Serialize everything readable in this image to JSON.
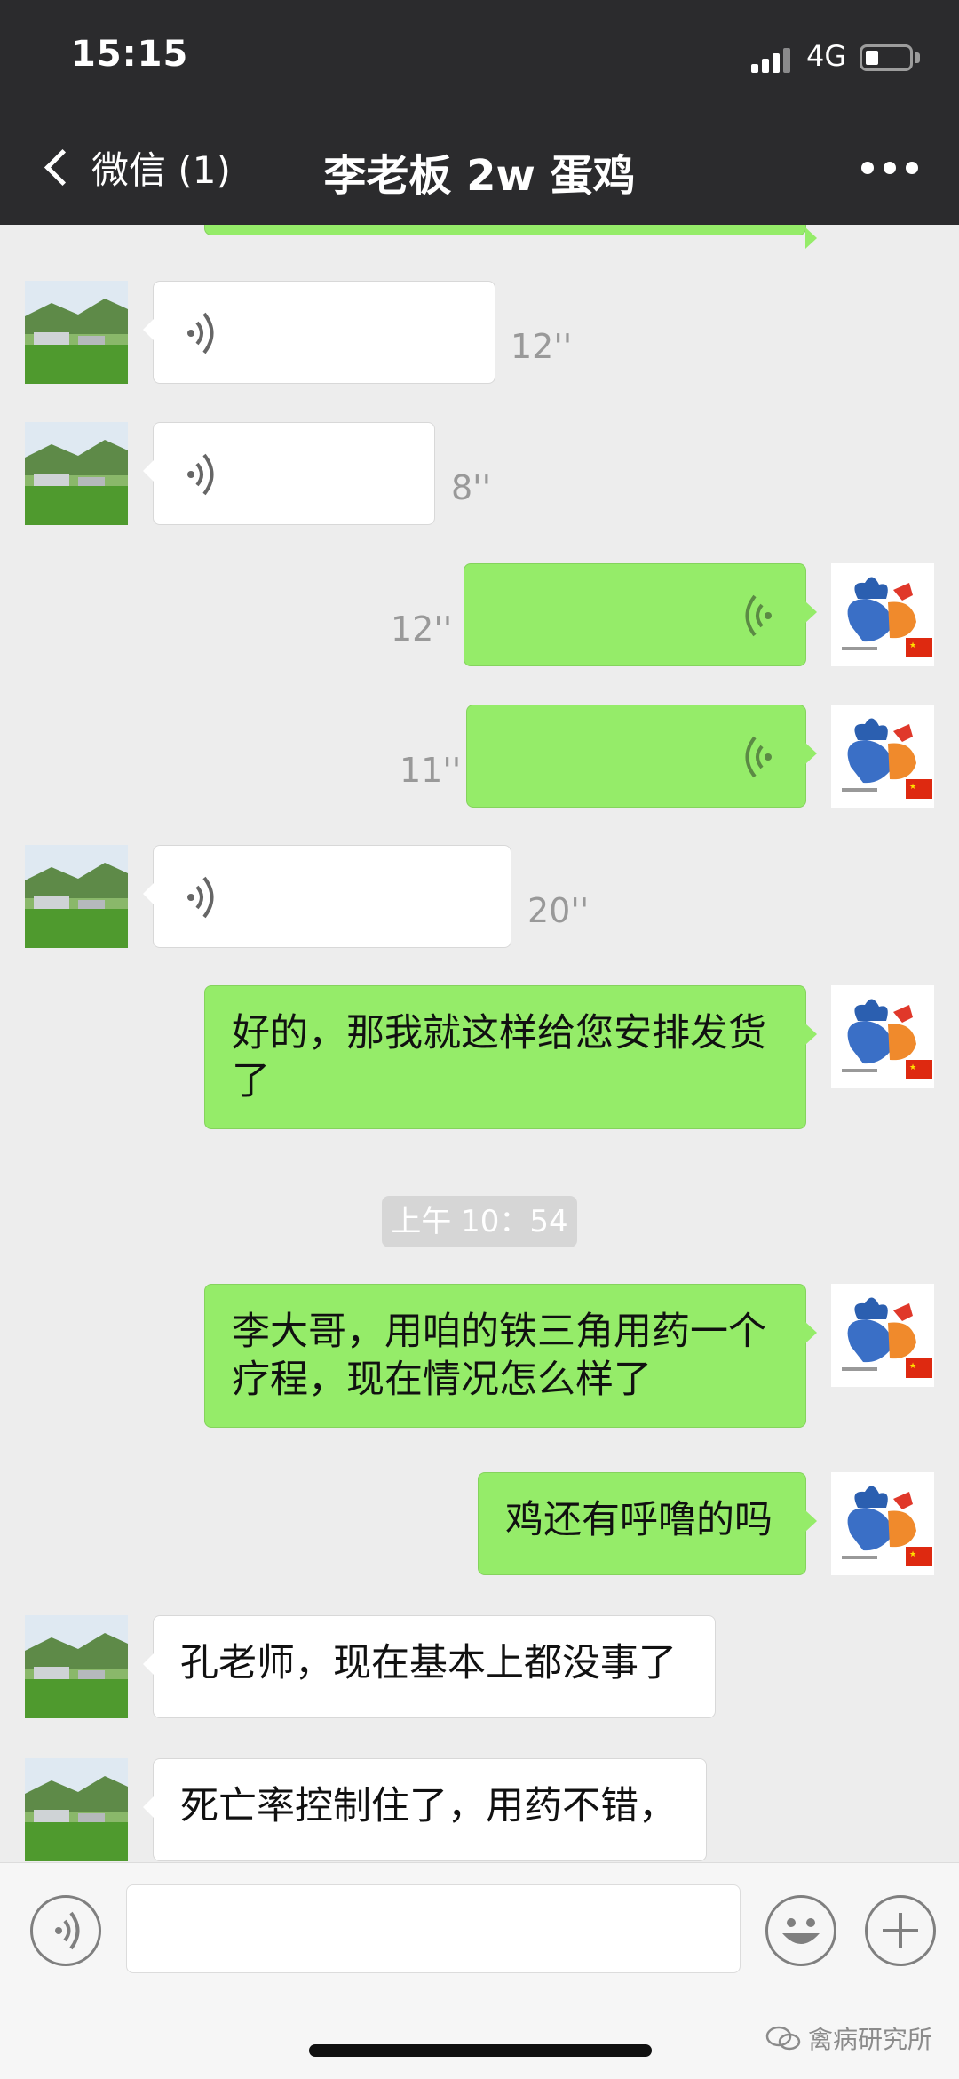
{
  "status_bar": {
    "time": "15:15",
    "network": "4G"
  },
  "nav": {
    "back_label": "微信 (1)",
    "title": "李老板 2w 蛋鸡"
  },
  "messages": [
    {
      "type": "voice",
      "side": "left",
      "duration": "12''"
    },
    {
      "type": "voice",
      "side": "left",
      "duration": "8''"
    },
    {
      "type": "voice",
      "side": "right",
      "duration": "12''"
    },
    {
      "type": "voice",
      "side": "right",
      "duration": "11''"
    },
    {
      "type": "voice",
      "side": "left",
      "duration": "20''"
    },
    {
      "type": "text",
      "side": "right",
      "text": "好的，那我就这样给您安排发货了"
    },
    {
      "type": "time",
      "text": "上午 10：54"
    },
    {
      "type": "text",
      "side": "right",
      "text": "李大哥，用咱的铁三角用药一个疗程，现在情况怎么样了"
    },
    {
      "type": "text",
      "side": "right",
      "text": "鸡还有呼噜的吗"
    },
    {
      "type": "text",
      "side": "left",
      "text": "孔老师，现在基本上都没事了"
    },
    {
      "type": "text",
      "side": "left",
      "text": "死亡率控制住了，用药不错，"
    }
  ],
  "input_bar": {
    "placeholder": ""
  },
  "watermark": {
    "text": "禽病研究所"
  },
  "colors": {
    "outgoing_bubble": "#95ec69",
    "incoming_bubble": "#ffffff",
    "nav_bg": "#2b2b2d",
    "chat_bg": "#ededed"
  },
  "icons": {
    "voice_toggle": "voice-icon",
    "emoji": "emoji-icon",
    "more": "plus-icon"
  }
}
